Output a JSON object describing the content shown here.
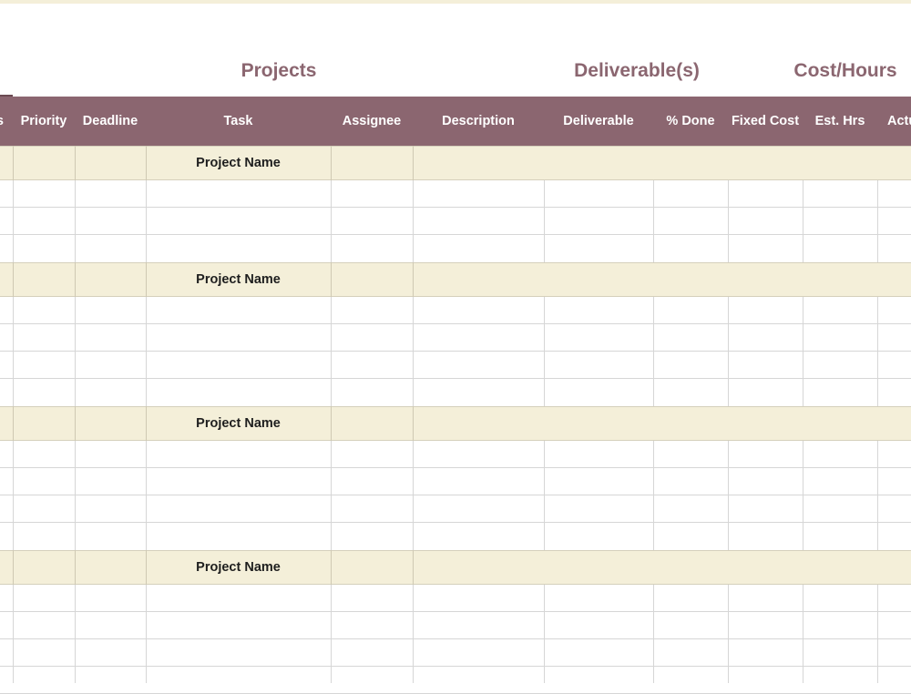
{
  "sections": {
    "projects": "Projects",
    "deliverables": "Deliverable(s)",
    "cost_hours": "Cost/Hours"
  },
  "columns": [
    "s",
    "Priority",
    "Deadline",
    "Task",
    "Assignee",
    "Description",
    "Deliverable",
    "% Done",
    "Fixed Cost",
    "Est. Hrs",
    "Actu"
  ],
  "project_groups": [
    {
      "name": "Project Name",
      "task_rows": 3
    },
    {
      "name": "Project Name",
      "task_rows": 4
    },
    {
      "name": "Project Name",
      "task_rows": 4
    },
    {
      "name": "Project Name",
      "task_rows": 4
    }
  ],
  "colors": {
    "header": "#8b6670",
    "project_row": "#f4efd9",
    "grid": "#d6d6d6",
    "title_text": "#8b6670"
  }
}
